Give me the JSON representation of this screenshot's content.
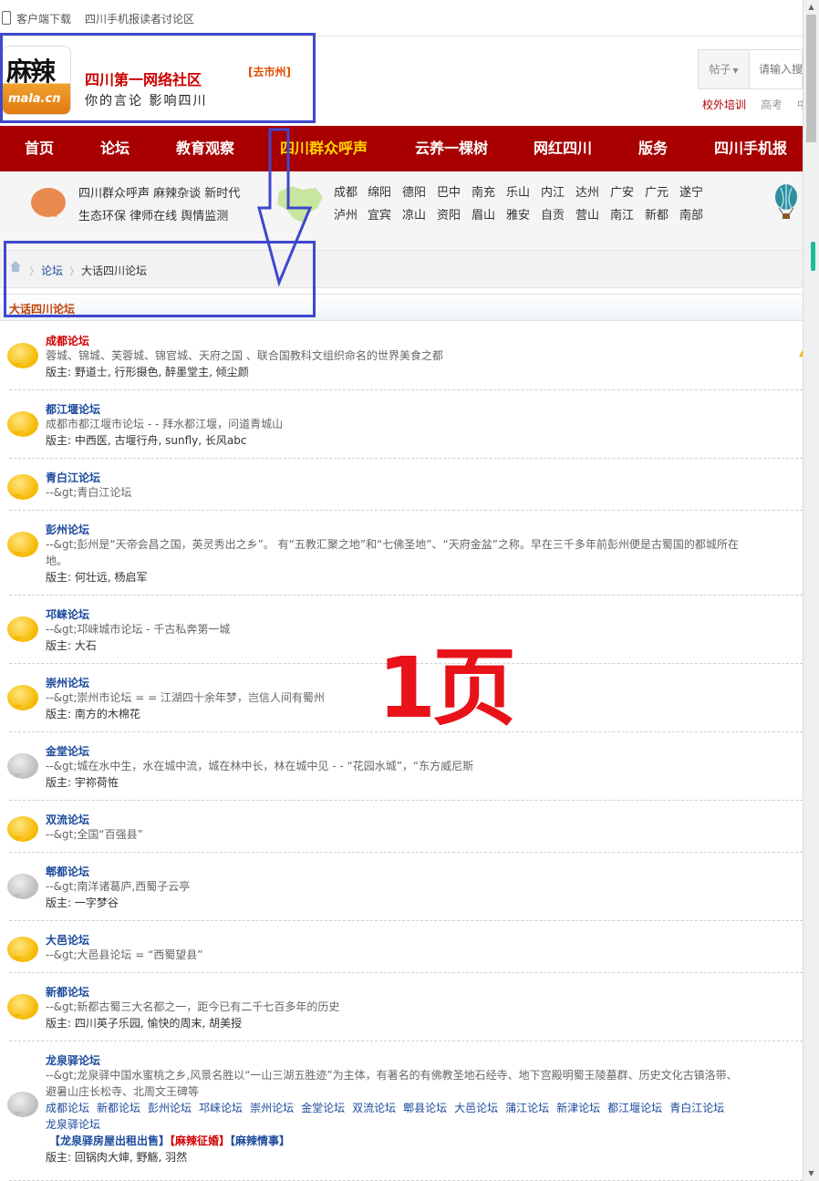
{
  "topbar": {
    "download": "客户端下载",
    "readers": "四川手机报读者讨论区"
  },
  "header": {
    "logo_cn": "麻辣",
    "logo_en": "mala.cn",
    "title": "四川第一网络社区",
    "slogan": "你的言论 影响四川",
    "city_switch": "[去市州]",
    "search_select": "帖子",
    "search_placeholder": "请输入搜",
    "quick_links": [
      "校外培训",
      "高考",
      "中"
    ]
  },
  "nav": [
    "首页",
    "论坛",
    "教育观察",
    "四川群众呼声",
    "云养一棵树",
    "网红四川",
    "版务",
    "四川手机报"
  ],
  "subbar": {
    "line1": "四川群众呼声 麻辣杂谈 新时代",
    "line2": "生态环保 律师在线 舆情监测",
    "cities_row1": [
      "成都",
      "绵阳",
      "德阳",
      "巴中",
      "南充",
      "乐山",
      "内江",
      "达州",
      "广安",
      "广元",
      "遂宁"
    ],
    "cities_row2": [
      "泸州",
      "宜宾",
      "凉山",
      "资阳",
      "眉山",
      "雅安",
      "自贡",
      "营山",
      "南江",
      "新都",
      "南部"
    ]
  },
  "breadcrumb": {
    "forum": "论坛",
    "current": "大话四川论坛"
  },
  "section_title": "大话四川论坛",
  "moderator_label": "版主: ",
  "forums": [
    {
      "name": "成都论坛",
      "desc": "蓉城、锦城、芙蓉城、锦官城、天府之国 、联合国教科文组织命名的世界美食之都",
      "mods": "野道士, 行形摄色, 醉墨堂主, 倾尘颜"
    },
    {
      "name": "都江堰论坛",
      "desc": "成都市都江堰市论坛 - - 拜水都江堰，问道青城山",
      "mods": "中西医, 古堰行舟, sunfly, 长风abc"
    },
    {
      "name": "青白江论坛",
      "desc": "--&gt;青白江论坛"
    },
    {
      "name": "彭州论坛",
      "desc": "--&gt;彭州是“天帝会昌之国，英灵秀出之乡”。 有“五教汇聚之地”和“七佛圣地”、“天府金盆”之称。早在三千多年前彭州便是古蜀国的都城所在地。",
      "mods": "何壮远, 杨启军"
    },
    {
      "name": "邛崃论坛",
      "desc": "--&gt;邛崃城市论坛 - 千古私奔第一城",
      "mods": "大石"
    },
    {
      "name": "崇州论坛",
      "desc": "--&gt;崇州市论坛 = = 江湖四十余年梦，岂信人间有蜀州",
      "mods": "南方的木棉花"
    },
    {
      "name": "金堂论坛",
      "desc": "--&gt;城在水中生，水在城中流，城在林中长，林在城中见 - - “花园水城”，“东方威尼斯",
      "mods": "宇祢荷恠"
    },
    {
      "name": "双流论坛",
      "desc": "--&gt;全国“百强县”"
    },
    {
      "name": "郫都论坛",
      "desc": "--&gt;南洋诸葛庐,西蜀子云亭",
      "mods": "一字梦谷"
    },
    {
      "name": "大邑论坛",
      "desc": "--&gt;大邑县论坛 = “西蜀望县”"
    },
    {
      "name": "新都论坛",
      "desc": "--&gt;新都古蜀三大名都之一，距今已有二千七百多年的历史",
      "mods": "四川英子乐园, 愉快的周末, 胡美授"
    },
    {
      "name": "龙泉驿论坛",
      "desc": "--&gt;龙泉驿中国水蜜桃之乡,风景名胜以“一山三湖五胜迹”为主体，有著名的有佛教圣地石经寺、地下宫殿明蜀王陵墓群、历史文化古镇洛带、避暑山庄长松寺、北周文王碑等",
      "links": [
        "成都论坛",
        "新都论坛",
        "彭州论坛",
        "邛崃论坛",
        "崇州论坛",
        "金堂论坛",
        "双流论坛",
        "郫县论坛",
        "大邑论坛",
        "蒲江论坛",
        "新津论坛",
        "都江堰论坛",
        "青白江论坛",
        "龙泉驿论坛"
      ],
      "tags": [
        "【龙泉驿房屋出租出售】",
        "【麻辣征婚】",
        "【麻辣情事】"
      ],
      "mods": "回锅肉大婶, 野觞, 羽然"
    }
  ],
  "overlay_text": "1页",
  "colors": {
    "nav_bg": "#a80000",
    "nav_active": "#ffd800",
    "link": "#1b4a9c",
    "annotation": "#3f48cc",
    "overlay": "#e8121a"
  }
}
